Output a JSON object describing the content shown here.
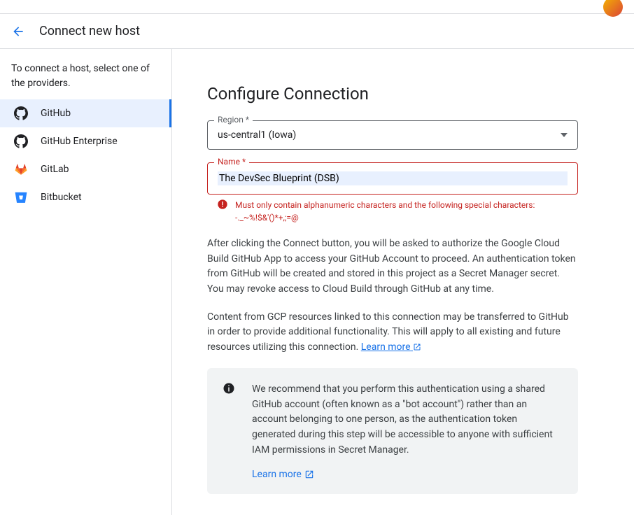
{
  "header": {
    "title": "Connect new host"
  },
  "sidebar": {
    "instruction": "To connect a host, select one of the providers.",
    "items": [
      {
        "label": "GitHub"
      },
      {
        "label": "GitHub Enterprise"
      },
      {
        "label": "GitLab"
      },
      {
        "label": "Bitbucket"
      }
    ]
  },
  "main": {
    "heading": "Configure Connection",
    "region": {
      "label": "Region *",
      "value": "us-central1 (Iowa)"
    },
    "name": {
      "label": "Name *",
      "value": "The DevSec Blueprint (DSB)",
      "error": "Must only contain alphanumeric characters and the following special characters: -._~%!$&'()*+,;=@"
    },
    "para1": "After clicking the Connect button, you will be asked to authorize the Google Cloud Build GitHub App to access your GitHub Account to proceed. An authentication token from GitHub will be created and stored in this project as a Secret Manager secret. You may revoke access to Cloud Build through GitHub at any time.",
    "para2_a": "Content from GCP resources linked to this connection may be transferred to GitHub in order to provide additional functionality. This will apply to all existing and future resources utilizing this connection. ",
    "learn_more": "Learn more",
    "info": {
      "text": "We recommend that you perform this authentication using a shared GitHub account (often known as a \"bot account\") rather than an account belonging to one person, as the authentication token generated during this step will be accessible to anyone with sufficient IAM permissions in Secret Manager.",
      "link": "Learn more"
    }
  }
}
